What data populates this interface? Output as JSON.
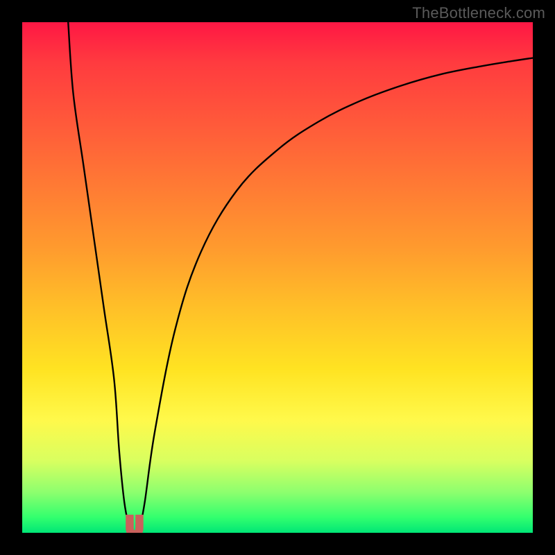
{
  "watermark": {
    "text": "TheBottleneck.com"
  },
  "colors": {
    "frame": "#000000",
    "gradient_top": "#ff1744",
    "gradient_mid1": "#ff7a34",
    "gradient_mid2": "#ffe322",
    "gradient_bottom": "#00e676",
    "curve_stroke": "#000000",
    "marker_fill": "#c9615c",
    "marker_stroke": "#c9615c"
  },
  "chart_data": {
    "type": "line",
    "title": "",
    "xlabel": "",
    "ylabel": "",
    "xlim": [
      0,
      100
    ],
    "ylim": [
      0,
      100
    ],
    "grid": false,
    "legend": false,
    "annotations": [],
    "series": [
      {
        "name": "bottleneck-left",
        "x": [
          9.0,
          10.0,
          12.0,
          14.0,
          16.0,
          18.0,
          19.0,
          20.0,
          21.0
        ],
        "y": [
          100.0,
          86.0,
          72.0,
          58.0,
          44.0,
          30.0,
          16.0,
          6.0,
          0.8
        ]
      },
      {
        "name": "bottleneck-right",
        "x": [
          23.0,
          24.0,
          26.0,
          30.0,
          35.0,
          42.0,
          50.0,
          58.0,
          66.0,
          74.0,
          82.0,
          90.0,
          96.0,
          100.0
        ],
        "y": [
          0.8,
          6.0,
          20.0,
          40.0,
          55.0,
          67.0,
          75.0,
          80.5,
          84.5,
          87.5,
          89.8,
          91.4,
          92.4,
          93.0
        ]
      }
    ],
    "marker": {
      "name": "optimal-point",
      "shape": "u",
      "cx": 22.0,
      "cy": 1.5,
      "width": 3.4,
      "height": 3.6
    }
  }
}
